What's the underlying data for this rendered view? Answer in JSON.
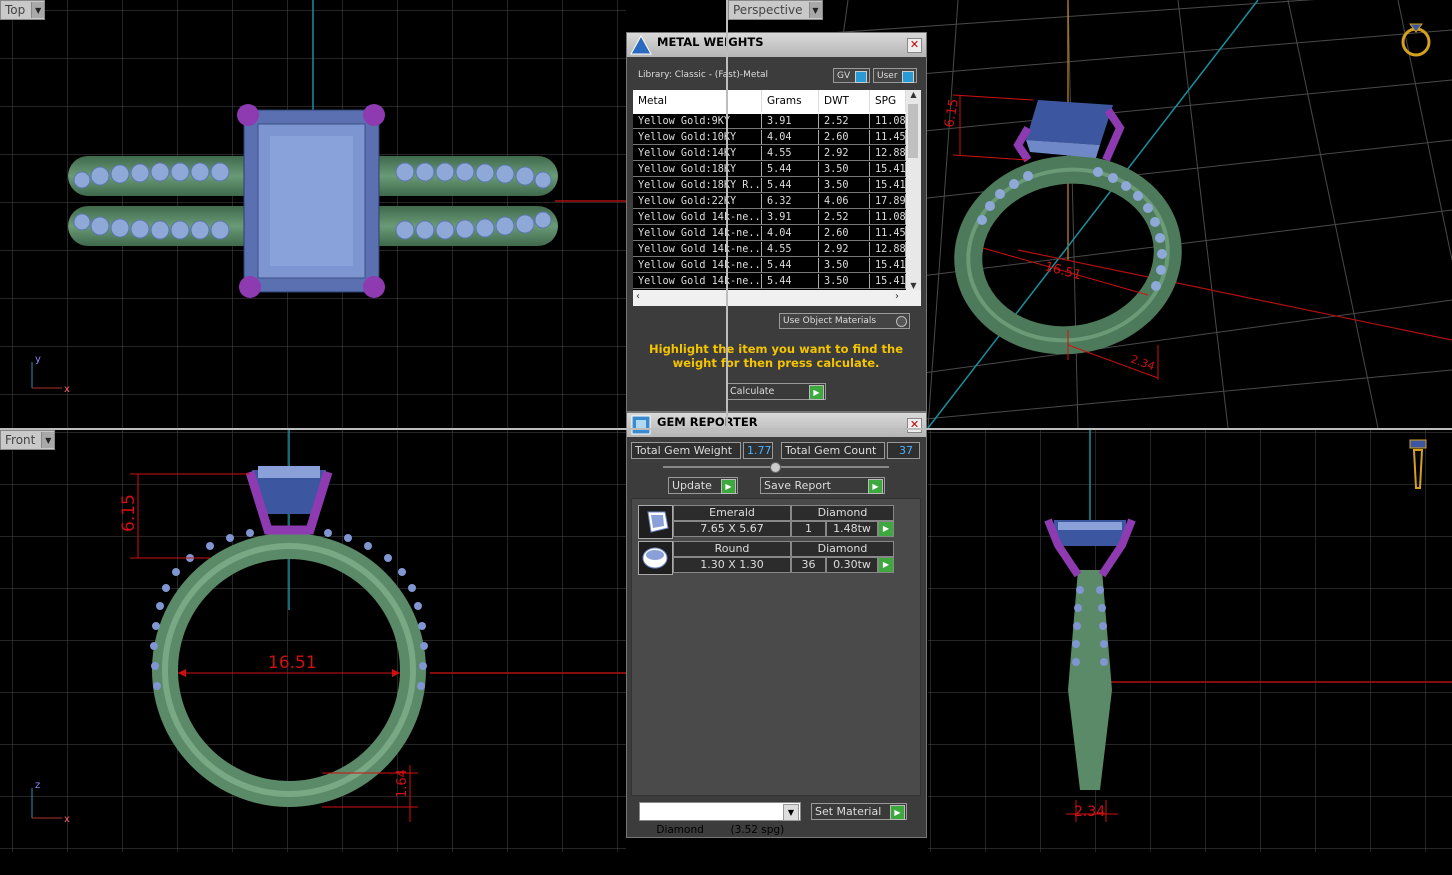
{
  "viewports": {
    "top": {
      "label": "Top",
      "axis_y": "y",
      "axis_x": "x"
    },
    "perspective": {
      "label": "Perspective",
      "dim_height": "6.15",
      "dim_diameter": "16.51",
      "dim_width": "2.34"
    },
    "front": {
      "label": "Front",
      "axis_z": "z",
      "axis_x": "x",
      "dim_height": "6.15",
      "dim_diameter": "16.51",
      "dim_shank": "1.64"
    },
    "right": {
      "dim_width": "2.34"
    }
  },
  "metal_weights": {
    "title": "METAL WEIGHTS",
    "library": "Library: Classic - (Fast)-Metal",
    "toggle_gv": "GV",
    "toggle_user": "User",
    "columns": [
      "Metal",
      "Grams",
      "DWT",
      "SPG"
    ],
    "rows": [
      [
        "Yellow Gold:9KY",
        "3.91",
        "2.52",
        "11.08"
      ],
      [
        "Yellow Gold:10KY",
        "4.04",
        "2.60",
        "11.45"
      ],
      [
        "Yellow Gold:14KY",
        "4.55",
        "2.92",
        "12.88"
      ],
      [
        "Yellow Gold:18KY",
        "5.44",
        "3.50",
        "15.41"
      ],
      [
        "Yellow Gold:18KY R...",
        "5.44",
        "3.50",
        "15.41"
      ],
      [
        "Yellow Gold:22KY",
        "6.32",
        "4.06",
        "17.89"
      ],
      [
        "Yellow Gold 14k-ne...",
        "3.91",
        "2.52",
        "11.08"
      ],
      [
        "Yellow Gold 14k-ne...",
        "4.04",
        "2.60",
        "11.45"
      ],
      [
        "Yellow Gold 14k-ne...",
        "4.55",
        "2.92",
        "12.88"
      ],
      [
        "Yellow Gold 14k-ne...",
        "5.44",
        "3.50",
        "15.41"
      ],
      [
        "Yellow Gold 14k-ne...",
        "5.44",
        "3.50",
        "15.41"
      ]
    ],
    "use_object_materials": "Use Object Materials",
    "message": "Highlight the item you want to find the weight for then press calculate.",
    "calculate_label": "Calculate"
  },
  "gem_reporter": {
    "title": "GEM REPORTER",
    "total_weight_label": "Total Gem Weight",
    "total_weight": "1.77",
    "total_count_label": "Total Gem Count",
    "total_count": "37",
    "update_label": "Update",
    "save_report_label": "Save Report",
    "gems": [
      {
        "shape": "Emerald",
        "material": "Diamond",
        "size": "7.65 X 5.67",
        "count": "1",
        "weight": "1.48tw"
      },
      {
        "shape": "Round",
        "material": "Diamond",
        "size": "1.30 X 1.30",
        "count": "36",
        "weight": "0.30tw"
      }
    ],
    "material_select": "Diamond        (3.52 spg)",
    "set_material_label": "Set Material"
  },
  "colors": {
    "metal": "#5b8a68",
    "stone": "#6f88c8",
    "prong": "#8e3ab0",
    "dim": "#d01010",
    "grid": "#555555",
    "axis_cyan": "#1a8fa0"
  }
}
